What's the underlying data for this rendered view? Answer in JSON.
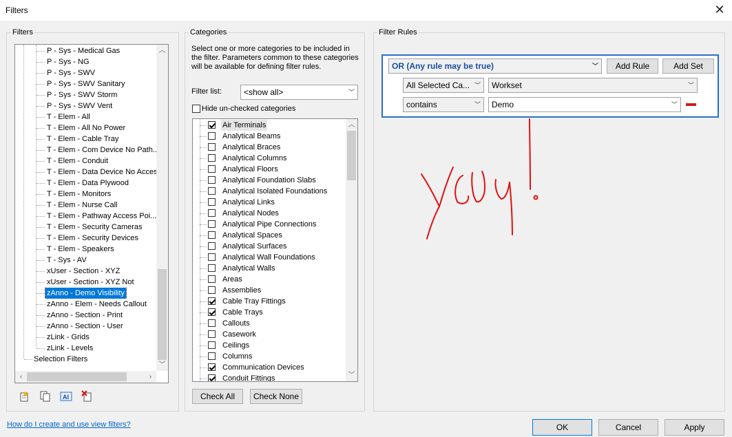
{
  "window": {
    "title": "Filters",
    "close_glyph": "✕"
  },
  "filters_panel": {
    "label": "Filters",
    "items": [
      "P - Sys - Medical Gas",
      "P - Sys - NG",
      "P - Sys - SWV",
      "P - Sys - SWV Sanitary",
      "P - Sys - SWV Storm",
      "P - Sys - SWV Vent",
      "T - Elem - All",
      "T - Elem - All No Power",
      "T - Elem - Cable Tray",
      "T - Elem - Com Device No Path...",
      "T - Elem - Conduit",
      "T - Elem - Data Device No Access",
      "T - Elem - Data Plywood",
      "T - Elem - Monitors",
      "T - Elem - Nurse Call",
      "T - Elem - Pathway Access Poi...",
      "T - Elem - Security Cameras",
      "T - Elem - Security Devices",
      "T - Elem - Speakers",
      "T - Sys - AV",
      "xUser - Section - XYZ",
      "xUser - Section - XYZ Not",
      "zAnno - Demo Visibility",
      "zAnno - Elem - Needs Callout",
      "zAnno - Section - Print",
      "zAnno - Section - User",
      "zLink - Grids",
      "zLink - Levels"
    ],
    "selected_index": 22,
    "footer_item": "Selection Filters",
    "icons": [
      "new-filter-icon",
      "duplicate-filter-icon",
      "rename-filter-icon",
      "delete-filter-icon"
    ]
  },
  "categories_panel": {
    "label": "Categories",
    "description": "Select one or more categories to be included in the filter.  Parameters common to these categories will be available for defining filter rules.",
    "filter_list_label": "Filter list:",
    "filter_list_value": "<show all>",
    "hide_unchecked_label": "Hide un-checked categories",
    "items": [
      {
        "label": "Air Terminals",
        "checked": true
      },
      {
        "label": "Analytical Beams",
        "checked": false
      },
      {
        "label": "Analytical Braces",
        "checked": false
      },
      {
        "label": "Analytical Columns",
        "checked": false
      },
      {
        "label": "Analytical Floors",
        "checked": false
      },
      {
        "label": "Analytical Foundation Slabs",
        "checked": false
      },
      {
        "label": "Analytical Isolated Foundations",
        "checked": false
      },
      {
        "label": "Analytical Links",
        "checked": false
      },
      {
        "label": "Analytical Nodes",
        "checked": false
      },
      {
        "label": "Analytical Pipe Connections",
        "checked": false
      },
      {
        "label": "Analytical Spaces",
        "checked": false
      },
      {
        "label": "Analytical Surfaces",
        "checked": false
      },
      {
        "label": "Analytical Wall Foundations",
        "checked": false
      },
      {
        "label": "Analytical Walls",
        "checked": false
      },
      {
        "label": "Areas",
        "checked": false
      },
      {
        "label": "Assemblies",
        "checked": false
      },
      {
        "label": "Cable Tray Fittings",
        "checked": true
      },
      {
        "label": "Cable Trays",
        "checked": true
      },
      {
        "label": "Callouts",
        "checked": false
      },
      {
        "label": "Casework",
        "checked": false
      },
      {
        "label": "Ceilings",
        "checked": false
      },
      {
        "label": "Columns",
        "checked": false
      },
      {
        "label": "Communication Devices",
        "checked": true
      },
      {
        "label": "Conduit Fittings",
        "checked": true
      }
    ],
    "check_all_label": "Check All",
    "check_none_label": "Check None"
  },
  "filter_rules": {
    "label": "Filter Rules",
    "logic": "OR (Any rule may be true)",
    "add_rule_label": "Add Rule",
    "add_set_label": "Add Set",
    "rules": [
      {
        "category": "All Selected Ca...",
        "parameter": "Workset"
      },
      {
        "operator": "contains",
        "value": "Demo"
      }
    ],
    "annotation_color": "#e01010"
  },
  "footer": {
    "help_link": "How do I create and use view filters?",
    "ok_label": "OK",
    "cancel_label": "Cancel",
    "apply_label": "Apply"
  }
}
